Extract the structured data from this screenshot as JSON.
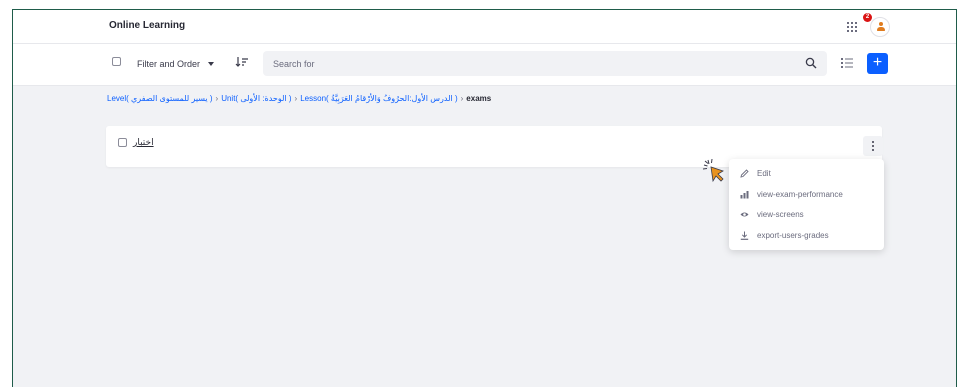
{
  "app": {
    "title": "Online Learning"
  },
  "header": {
    "notification_count": "2"
  },
  "toolbar": {
    "filter_label": "Filter and Order",
    "search_placeholder": "Search for"
  },
  "breadcrumb": [
    {
      "label": "Level( يسير للمستوى الصفري )"
    },
    {
      "label": "Unit( الوحدة: الأولى )"
    },
    {
      "label": "Lesson( الدرس الأول:الحرُوفُ وَالأرْقامُ العَرَبِيَّةُ )"
    },
    {
      "label": "exams"
    }
  ],
  "card": {
    "title": "اختبار"
  },
  "menu": {
    "items": [
      {
        "label": "Edit",
        "icon": "pencil-icon"
      },
      {
        "label": "view-exam-performance",
        "icon": "chart-icon"
      },
      {
        "label": "view-screens",
        "icon": "eye-icon"
      },
      {
        "label": "export-users-grades",
        "icon": "download-icon"
      }
    ]
  },
  "colors": {
    "primary": "#0b5fff",
    "badge": "#da1414",
    "frame": "#1f5c4a",
    "cursor": "#e8931f"
  }
}
